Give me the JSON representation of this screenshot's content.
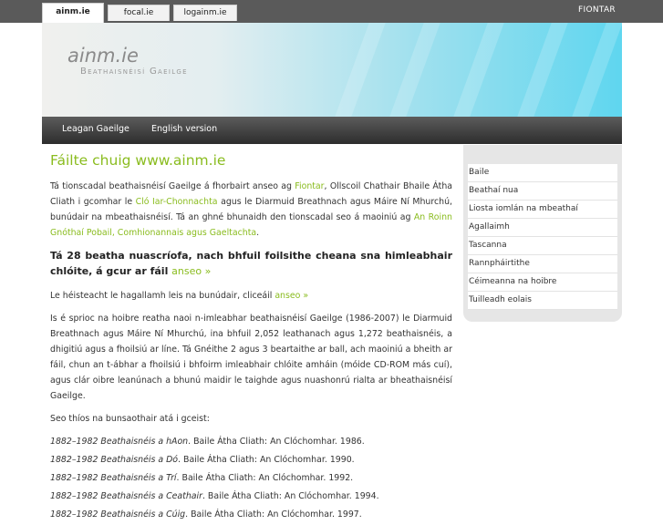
{
  "topbar": {
    "tabs": [
      "ainm.ie",
      "focal.ie",
      "logainm.ie"
    ],
    "right_link": "FIONTAR"
  },
  "header": {
    "site_title": "ainm.ie",
    "subtitle": "Beathaisnéisí Gaeilge"
  },
  "nav": [
    "Leagan Gaeilge",
    "English version"
  ],
  "main": {
    "heading": "Fáilte chuig www.ainm.ie",
    "intro": {
      "t1": "Tá tionscadal beathaisnéisí Gaeilge á fhorbairt anseo ag ",
      "l1": "Fiontar",
      "t2": ", Ollscoil Chathair Bhaile Átha Cliath i gcomhar le ",
      "l2": "Cló Iar-Chonnachta",
      "t3": " agus le Diarmuid Breathnach agus Máire Ní Mhurchú, bunúdair na mbeathaisnéisí. Tá an ghné bhunaidh den tionscadal seo á maoiniú ag ",
      "l3": "An Roinn Gnóthaí Pobail, Comhionannais agus Gaeltachta",
      "t4": "."
    },
    "highlight": {
      "text": "Tá 28 beatha nuascríofa, nach bhfuil foilsithe cheana sna himleabhair chlóite, á gcur ar fáil ",
      "link": "anseo »"
    },
    "interview": {
      "text": "Le héisteacht le hagallamh leis na bunúdair, cliceáil ",
      "link": "anseo »"
    },
    "aim": "Is é sprioc na hoibre reatha naoi n-imleabhar beathaisnéisí Gaeilge (1986-2007) le Diarmuid Breathnach agus Máire Ní Mhurchú, ina bhfuil 2,052 leathanach agus 1,272 beathaisnéis, a dhigitiú agus a fhoilsiú ar líne. Tá Gnéithe 2 agus 3 beartaithe ar ball, ach maoiniú a bheith ar fáil, chun an t-ábhar a fhoilsiú i bhfoirm imleabhair chlóite amháin (móide CD-ROM más cuí), agus clár oibre leanúnach a bhunú maidir le taighde agus nuashonrú rialta ar bheathaisnéisí Gaeilge.",
    "sources_intro": "Seo thíos na bunsaothair atá i gceist:",
    "references": [
      {
        "title": "1882–1982 Beathaisnéis a hAon",
        "rest": ". Baile Átha Cliath: An Clóchomhar. 1986."
      },
      {
        "title": "1882–1982 Beathaisnéis a Dó",
        "rest": ". Baile Átha Cliath: An Clóchomhar. 1990."
      },
      {
        "title": "1882–1982 Beathaisnéis a Trí",
        "rest": ". Baile Átha Cliath: An Clóchomhar. 1992."
      },
      {
        "title": "1882–1982 Beathaisnéis a Ceathair",
        "rest": ". Baile Átha Cliath: An Clóchomhar. 1994."
      },
      {
        "title": "1882–1982 Beathaisnéis a Cúig",
        "rest": ". Baile Átha Cliath: An Clóchomhar. 1997."
      }
    ]
  },
  "sidebar": {
    "items": [
      "Baile",
      "Beathaí nua",
      "Liosta iomlán na mbeathaí",
      "Agallaimh",
      "Tascanna",
      "Rannpháirtithe",
      "Céimeanna na hoibre",
      "Tuilleadh eolais"
    ]
  },
  "colors": {
    "link_green": "#8abc1f",
    "nav_dark": "#2d2d2d",
    "banner_cyan": "#5fd6ef"
  }
}
